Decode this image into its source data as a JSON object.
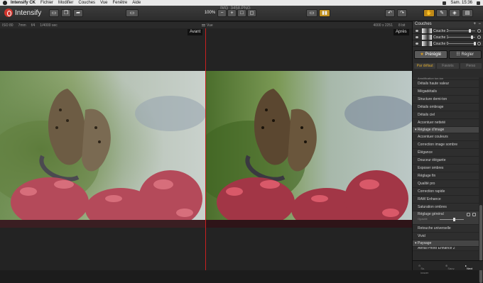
{
  "menubar": {
    "app": "Intensify CK",
    "items": [
      "Fichier",
      "Modifier",
      "Couches",
      "Vue",
      "Fenêtre",
      "Aide"
    ],
    "clock": "Sam. 15:36"
  },
  "toolbar": {
    "brand": "Intensify",
    "zoom": "100%",
    "window_title": "IMG_3458.PNG"
  },
  "infobar": {
    "iso": "ISO 80",
    "focal": "7mm",
    "aperture": "f/4",
    "shutter": "1/4000 sec",
    "mode_label": "Vue",
    "dimensions": "4000 x 2251",
    "bits": "8 bit"
  },
  "viewer": {
    "before_label": "Avant",
    "after_label": "Après"
  },
  "panel": {
    "title": "Couches",
    "layers": [
      {
        "name": "Couche 2",
        "opacity": 0.75
      },
      {
        "name": "Couche 1",
        "opacity": 0.85
      },
      {
        "name": "Couche 0",
        "opacity": 1.0
      }
    ],
    "preset_button": "Préréglé",
    "adjust_button": "Régler",
    "filters": [
      "Par défaut",
      "Favoris",
      "Perso"
    ],
    "list_top_cut": "Amplification ton-ton",
    "group1_items": [
      "Détails haute valeur",
      "Mégadétails",
      "Structure demi-ton",
      "Détails ombrage",
      "Détails ciel",
      "Accentuer netteté"
    ],
    "group2_title": "Réglage d'image",
    "group2_items": [
      "Accentuer couleurs",
      "Correction image sombre",
      "Élégance",
      "Douceur élégante",
      "Exposer ombres",
      "Réglage fin",
      "Qualité pro",
      "Correction rapide",
      "RAW Enhance",
      "Saturation ombres"
    ],
    "selected_item": "Réglage général",
    "selected_sub": "Opacité",
    "selected_opacity": 0.55,
    "group2_items_after": [
      "Retouche universelle",
      "Vivid"
    ],
    "group3_title": "Paysage",
    "group3_cut": "Aerial Photo Enhance 2",
    "footer_delete": "Su. leaver",
    "footer_save": "Sauv.",
    "footer_next": "Next",
    "accent": "#e0a020"
  }
}
